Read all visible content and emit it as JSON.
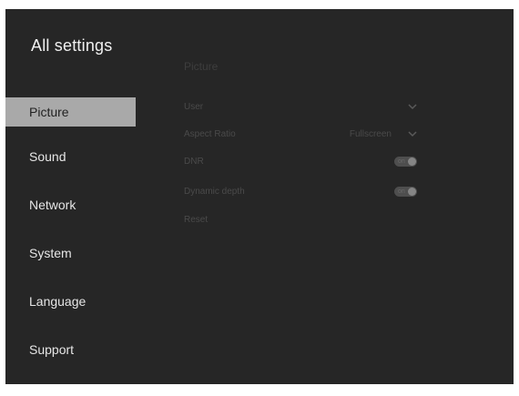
{
  "sidebar": {
    "title": "All settings",
    "items": [
      {
        "label": "Picture",
        "selected": true
      },
      {
        "label": "Sound",
        "selected": false
      },
      {
        "label": "Network",
        "selected": false
      },
      {
        "label": "System",
        "selected": false
      },
      {
        "label": "Language",
        "selected": false
      },
      {
        "label": "Support",
        "selected": false
      }
    ]
  },
  "main": {
    "section_title": "Picture",
    "settings": [
      {
        "label": "User",
        "control": "dropdown",
        "icon": "chevron-down-icon"
      },
      {
        "label": "Aspect Ratio",
        "value": "Fullscreen",
        "control": "dropdown",
        "icon": "chevron-down-icon"
      },
      {
        "label": "DNR",
        "control": "toggle",
        "state": "on"
      },
      {
        "label": "Dynamic depth",
        "control": "toggle",
        "state": "on"
      },
      {
        "label": "Reset",
        "control": "action"
      }
    ]
  },
  "colors": {
    "background": "#262626",
    "selected_item_bg": "#a9a9a9",
    "text_primary": "#e6e6e6",
    "text_disabled": "#4a4a4a"
  }
}
